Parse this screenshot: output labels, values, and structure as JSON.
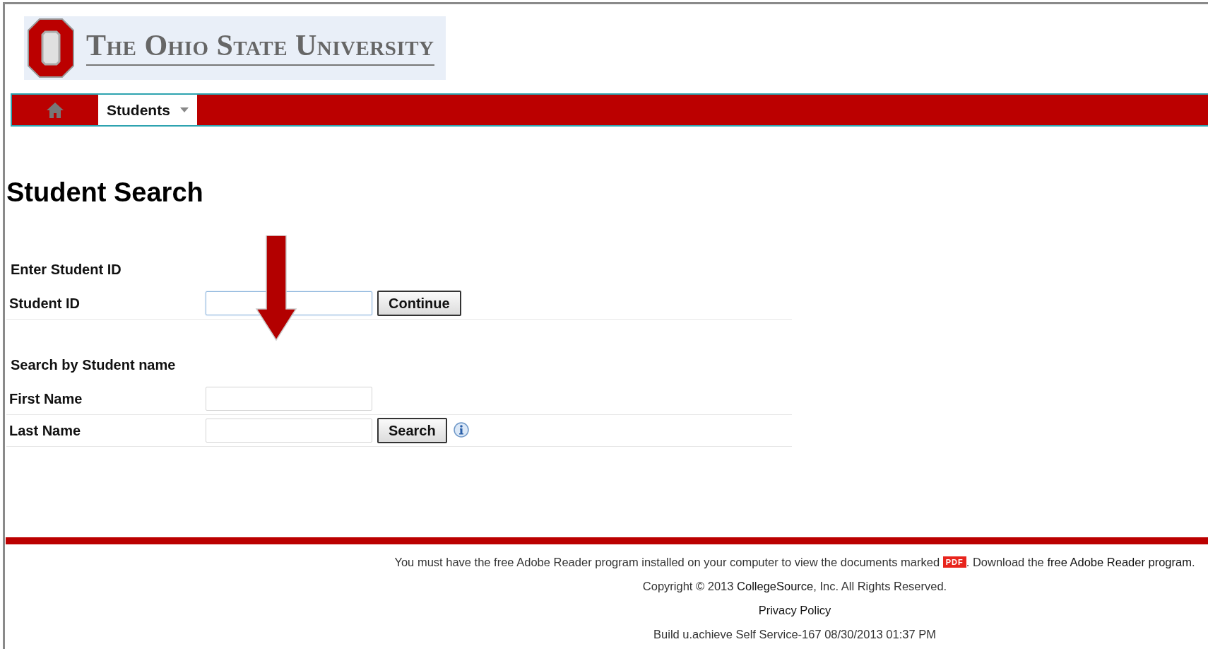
{
  "logo": {
    "text": "The Ohio State University"
  },
  "nav": {
    "items": [
      {
        "kind": "home",
        "selected": false
      },
      {
        "kind": "menu",
        "label": "Students",
        "selected": true
      }
    ]
  },
  "page_title": "Student Search",
  "sections": [
    {
      "heading": "Enter Student ID",
      "rows": [
        {
          "label": "Student ID",
          "focused": true,
          "button": "Continue",
          "info": false
        }
      ]
    },
    {
      "heading": "Search by Student name",
      "rows": [
        {
          "label": "First Name",
          "focused": false,
          "info": false
        },
        {
          "label": "Last Name",
          "focused": false,
          "button": "Search",
          "info": true
        }
      ]
    }
  ],
  "footer": {
    "notice": {
      "before": "You must have the free Adobe Reader program installed on your computer to view the documents marked",
      "badge": "PDF",
      "middle": ". Download the",
      "link": "free Adobe Reader program",
      "after": "."
    },
    "copyright": {
      "before": "Copyright © 2013",
      "link": "CollegeSource",
      "after": ", Inc. All Rights Reserved."
    },
    "privacy": "Privacy Policy",
    "build": "Build u.achieve Self Service-167 08/30/2013 01:37 PM"
  }
}
